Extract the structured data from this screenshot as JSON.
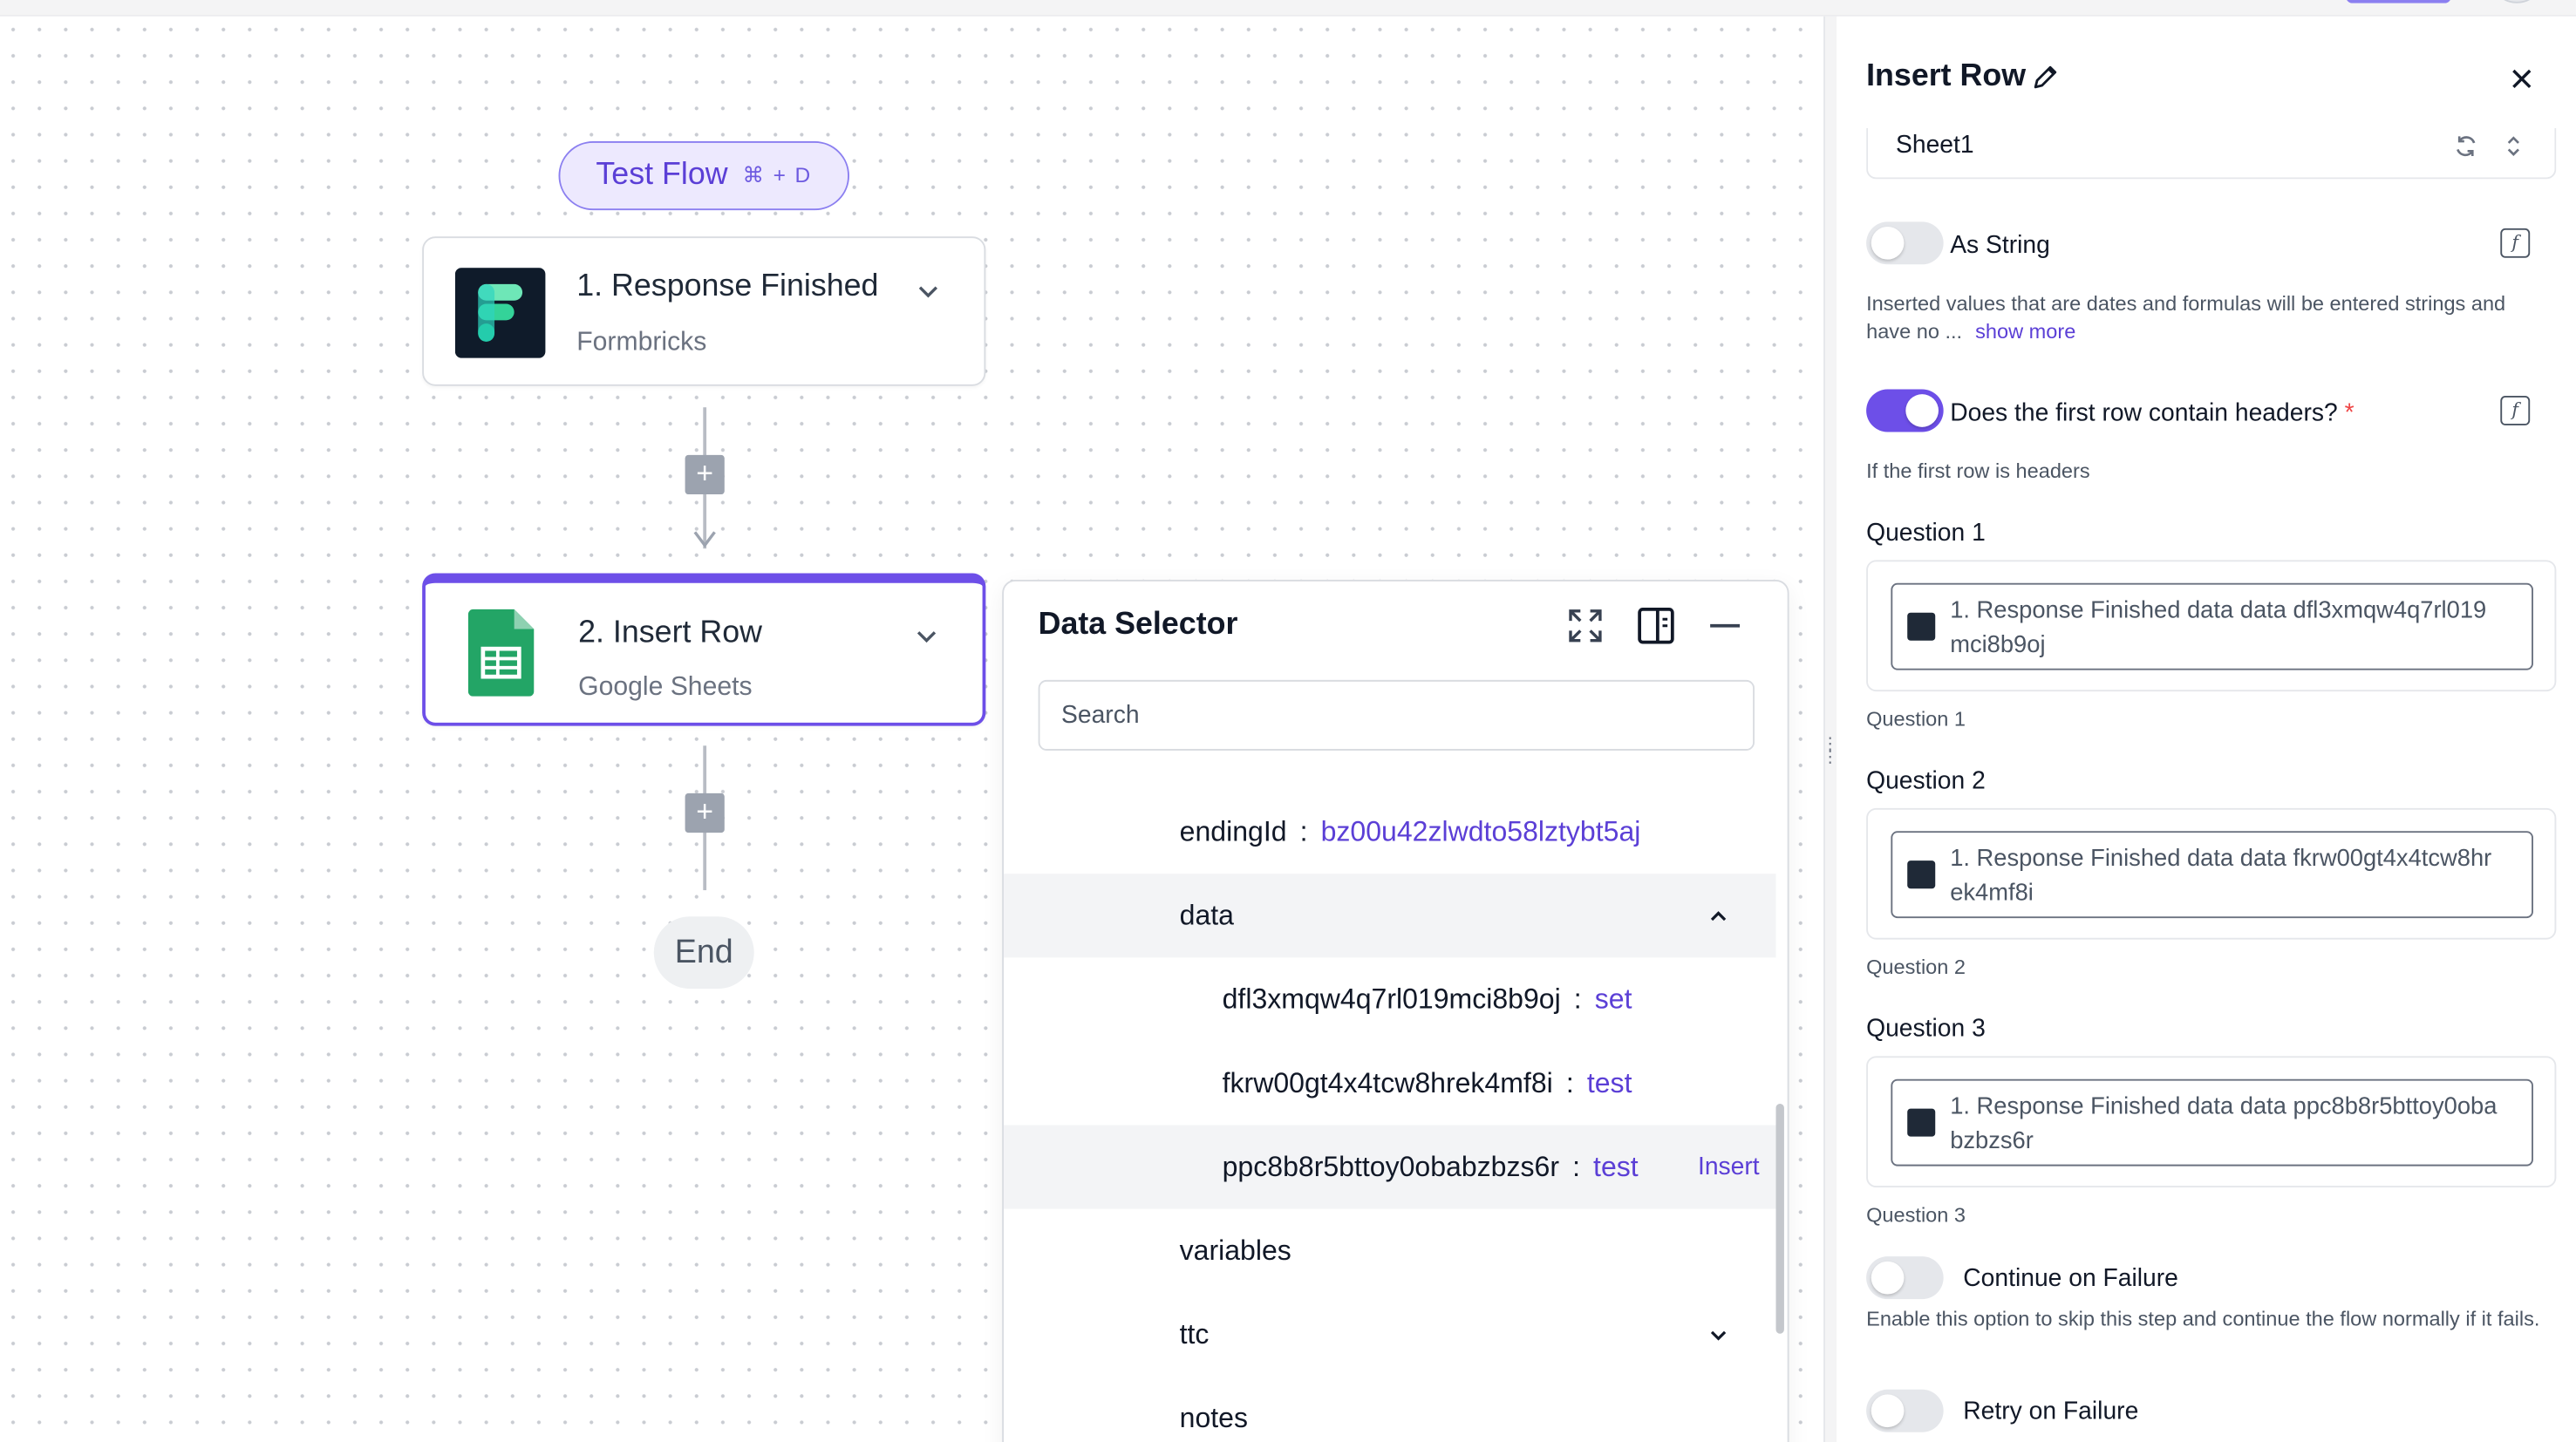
{
  "canvas": {
    "test_flow_label": "Test Flow",
    "test_flow_shortcut": "⌘ + D",
    "steps": [
      {
        "title": "1. Response Finished",
        "subtitle": "Formbricks"
      },
      {
        "title": "2. Insert Row",
        "subtitle": "Google Sheets"
      }
    ],
    "end_label": "End"
  },
  "data_selector": {
    "title": "Data Selector",
    "search_placeholder": "Search",
    "rows": [
      {
        "key": "endingId",
        "value": "bz00u42zlwdto58lztybt5aj"
      },
      {
        "key": "data"
      },
      {
        "key": "dfl3xmqw4q7rl019mci8b9oj",
        "value": "set"
      },
      {
        "key": "fkrw00gt4x4tcw8hrek4mf8i",
        "value": "test"
      },
      {
        "key": "ppc8b8r5bttoy0obabzbzs6r",
        "value": "test",
        "action": "Insert"
      },
      {
        "key": "variables"
      },
      {
        "key": "ttc"
      },
      {
        "key": "notes"
      }
    ]
  },
  "panel": {
    "title": "Insert Row",
    "sheet_value": "Sheet1",
    "as_string": {
      "label": "As String",
      "help": "Inserted values that are dates and formulas will be entered strings and have no ...",
      "show_more": "show more"
    },
    "headers": {
      "label": "Does the first row contain headers?",
      "required_mark": "*",
      "help": "If the first row is headers"
    },
    "questions": [
      {
        "label": "Question 1",
        "value": "1. Response Finished data data dfl3xmqw4q7rl019mci8b9oj",
        "line1": "1. Response Finished data data dfl3xmqw4q7rl019",
        "line2": "mci8b9oj",
        "help": "Question 1"
      },
      {
        "label": "Question 2",
        "value": "1. Response Finished data data fkrw00gt4x4tcw8hrek4mf8i",
        "line1": "1. Response Finished data data fkrw00gt4x4tcw8hr",
        "line2": "ek4mf8i",
        "help": "Question 2"
      },
      {
        "label": "Question 3",
        "value": "1. Response Finished data data ppc8b8r5bttoy0obabzbzs6r",
        "line1": "1. Response Finished data data ppc8b8r5bttoy0oba",
        "line2": "bzbzs6r",
        "help": "Question 3"
      }
    ],
    "continue_on_failure": {
      "label": "Continue on Failure",
      "help": "Enable this option to skip this step and continue the flow normally if it fails."
    },
    "retry_on_failure": {
      "label": "Retry on Failure"
    }
  },
  "colors": {
    "accent": "#6d4fe8",
    "link": "#5b3fd6"
  },
  "icons": [
    "formbricks-logo",
    "google-sheets-icon",
    "chevron-down-icon",
    "plus-icon",
    "expand-icon",
    "dock-panel-icon",
    "minimize-icon",
    "chevron-up-icon",
    "pencil-icon",
    "close-icon",
    "refresh-icon",
    "chevron-updown-icon",
    "function-icon",
    "drag-handle-icon"
  ]
}
